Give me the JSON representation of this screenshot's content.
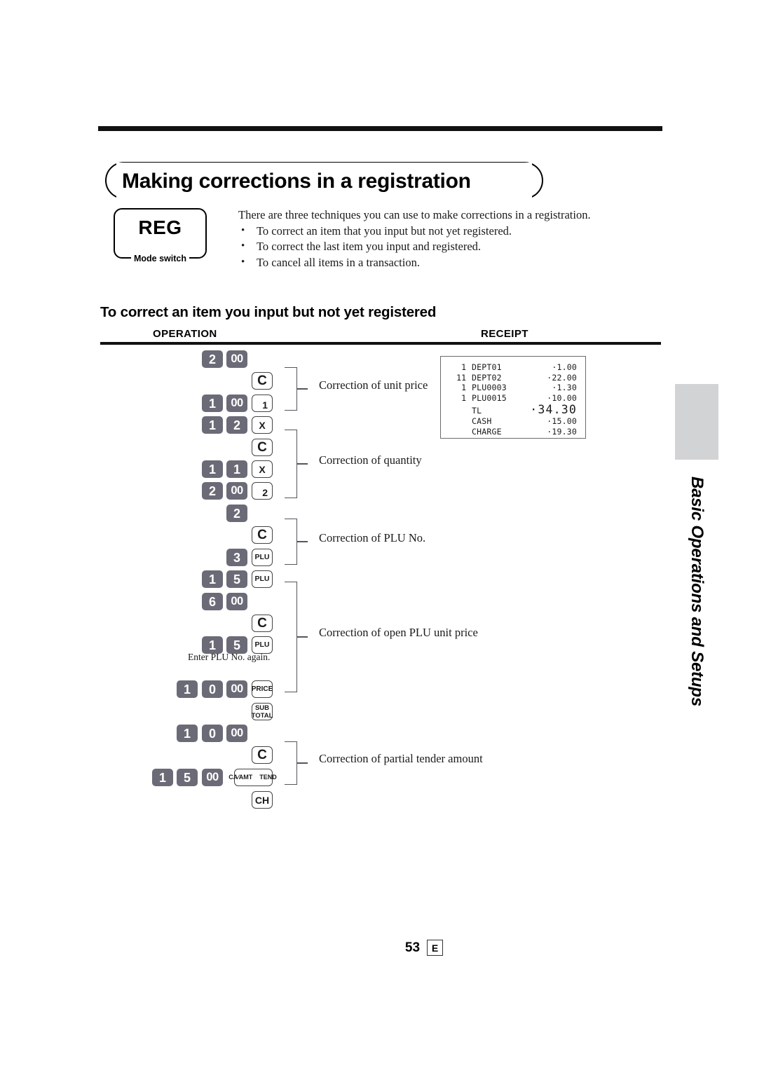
{
  "document": {
    "title": "Making corrections in a registration",
    "mode_switch": {
      "value": "REG",
      "caption": "Mode switch"
    },
    "intro": {
      "lead": "There are three techniques you can use to make corrections in a registration.",
      "bullets": [
        "To correct an item that you input but not yet registered.",
        "To correct the last item you input and registered.",
        "To cancel all items in a transaction."
      ]
    },
    "section_heading": "To correct an item you input but not yet registered",
    "columns": {
      "operation": "OPERATION",
      "receipt": "RECEIPT"
    },
    "note": "Enter PLU No. again.",
    "footer": {
      "page": "53",
      "language": "E"
    },
    "side_tab": "Basic Operations and Setups"
  },
  "keys": {
    "rows": [
      {
        "id": "r1",
        "keys": [
          "2",
          "00"
        ]
      },
      {
        "id": "r2",
        "keys": [
          "C"
        ]
      },
      {
        "id": "r3",
        "keys": [
          "1",
          "00",
          "1"
        ]
      },
      {
        "id": "r4",
        "keys": [
          "1",
          "2",
          "X"
        ]
      },
      {
        "id": "r5",
        "keys": [
          "C"
        ]
      },
      {
        "id": "r6",
        "keys": [
          "1",
          "1",
          "X"
        ]
      },
      {
        "id": "r7",
        "keys": [
          "2",
          "00",
          "2"
        ]
      },
      {
        "id": "r8",
        "keys": [
          "2"
        ]
      },
      {
        "id": "r9",
        "keys": [
          "C"
        ]
      },
      {
        "id": "r10",
        "keys": [
          "3",
          "PLU"
        ]
      },
      {
        "id": "r11",
        "keys": [
          "1",
          "5",
          "PLU"
        ]
      },
      {
        "id": "r12",
        "keys": [
          "6",
          "00"
        ]
      },
      {
        "id": "r13",
        "keys": [
          "C"
        ]
      },
      {
        "id": "r14",
        "keys": [
          "1",
          "5",
          "PLU"
        ]
      },
      {
        "id": "r15",
        "keys": [
          "1",
          "0",
          "00",
          "PRICE"
        ]
      },
      {
        "id": "r16",
        "keys": [
          "SUB TOTAL"
        ]
      },
      {
        "id": "r17",
        "keys": [
          "1",
          "0",
          "00"
        ]
      },
      {
        "id": "r18",
        "keys": [
          "C"
        ]
      },
      {
        "id": "r19",
        "keys": [
          "1",
          "5",
          "00",
          "CA/AMT TEND"
        ]
      },
      {
        "id": "r20",
        "keys": [
          "CH"
        ]
      }
    ],
    "labels": {
      "k2": "2",
      "k00": "00",
      "k1": "1",
      "kC": "C",
      "kX": "X",
      "kdept1": "1",
      "kdept2": "2",
      "kPLU": "PLU",
      "k3": "3",
      "k5": "5",
      "k6": "6",
      "k0": "0",
      "kPRICE": "PRICE",
      "kSUB": "SUB",
      "kTOTAL": "TOTAL",
      "kCA": "CA",
      "kAMT": "AMT",
      "kTEND": "TEND",
      "kCH": "CH"
    }
  },
  "descriptions": [
    "Correction of unit price",
    "Correction of quantity",
    "Correction of PLU No.",
    "Correction of open PLU unit price",
    "Correction of partial tender amount"
  ],
  "receipt": {
    "lines": [
      {
        "qty": "1",
        "name": "DEPT01",
        "amount": "·1.00",
        "total": false
      },
      {
        "qty": "11",
        "name": "DEPT02",
        "amount": "·22.00",
        "total": false
      },
      {
        "qty": "1",
        "name": "PLU0003",
        "amount": "·1.30",
        "total": false
      },
      {
        "qty": "1",
        "name": "PLU0015",
        "amount": "·10.00",
        "total": false
      },
      {
        "qty": "",
        "name": "TL",
        "amount": "·34.30",
        "total": true
      },
      {
        "qty": "",
        "name": "CASH",
        "amount": "·15.00",
        "total": false
      },
      {
        "qty": "",
        "name": "CHARGE",
        "amount": "·19.30",
        "total": false
      }
    ]
  },
  "colors": {
    "num_key": "#6b6b77",
    "fn_key_border": "#444444",
    "tab_block": "#d2d3d5",
    "rule": "#111111"
  }
}
